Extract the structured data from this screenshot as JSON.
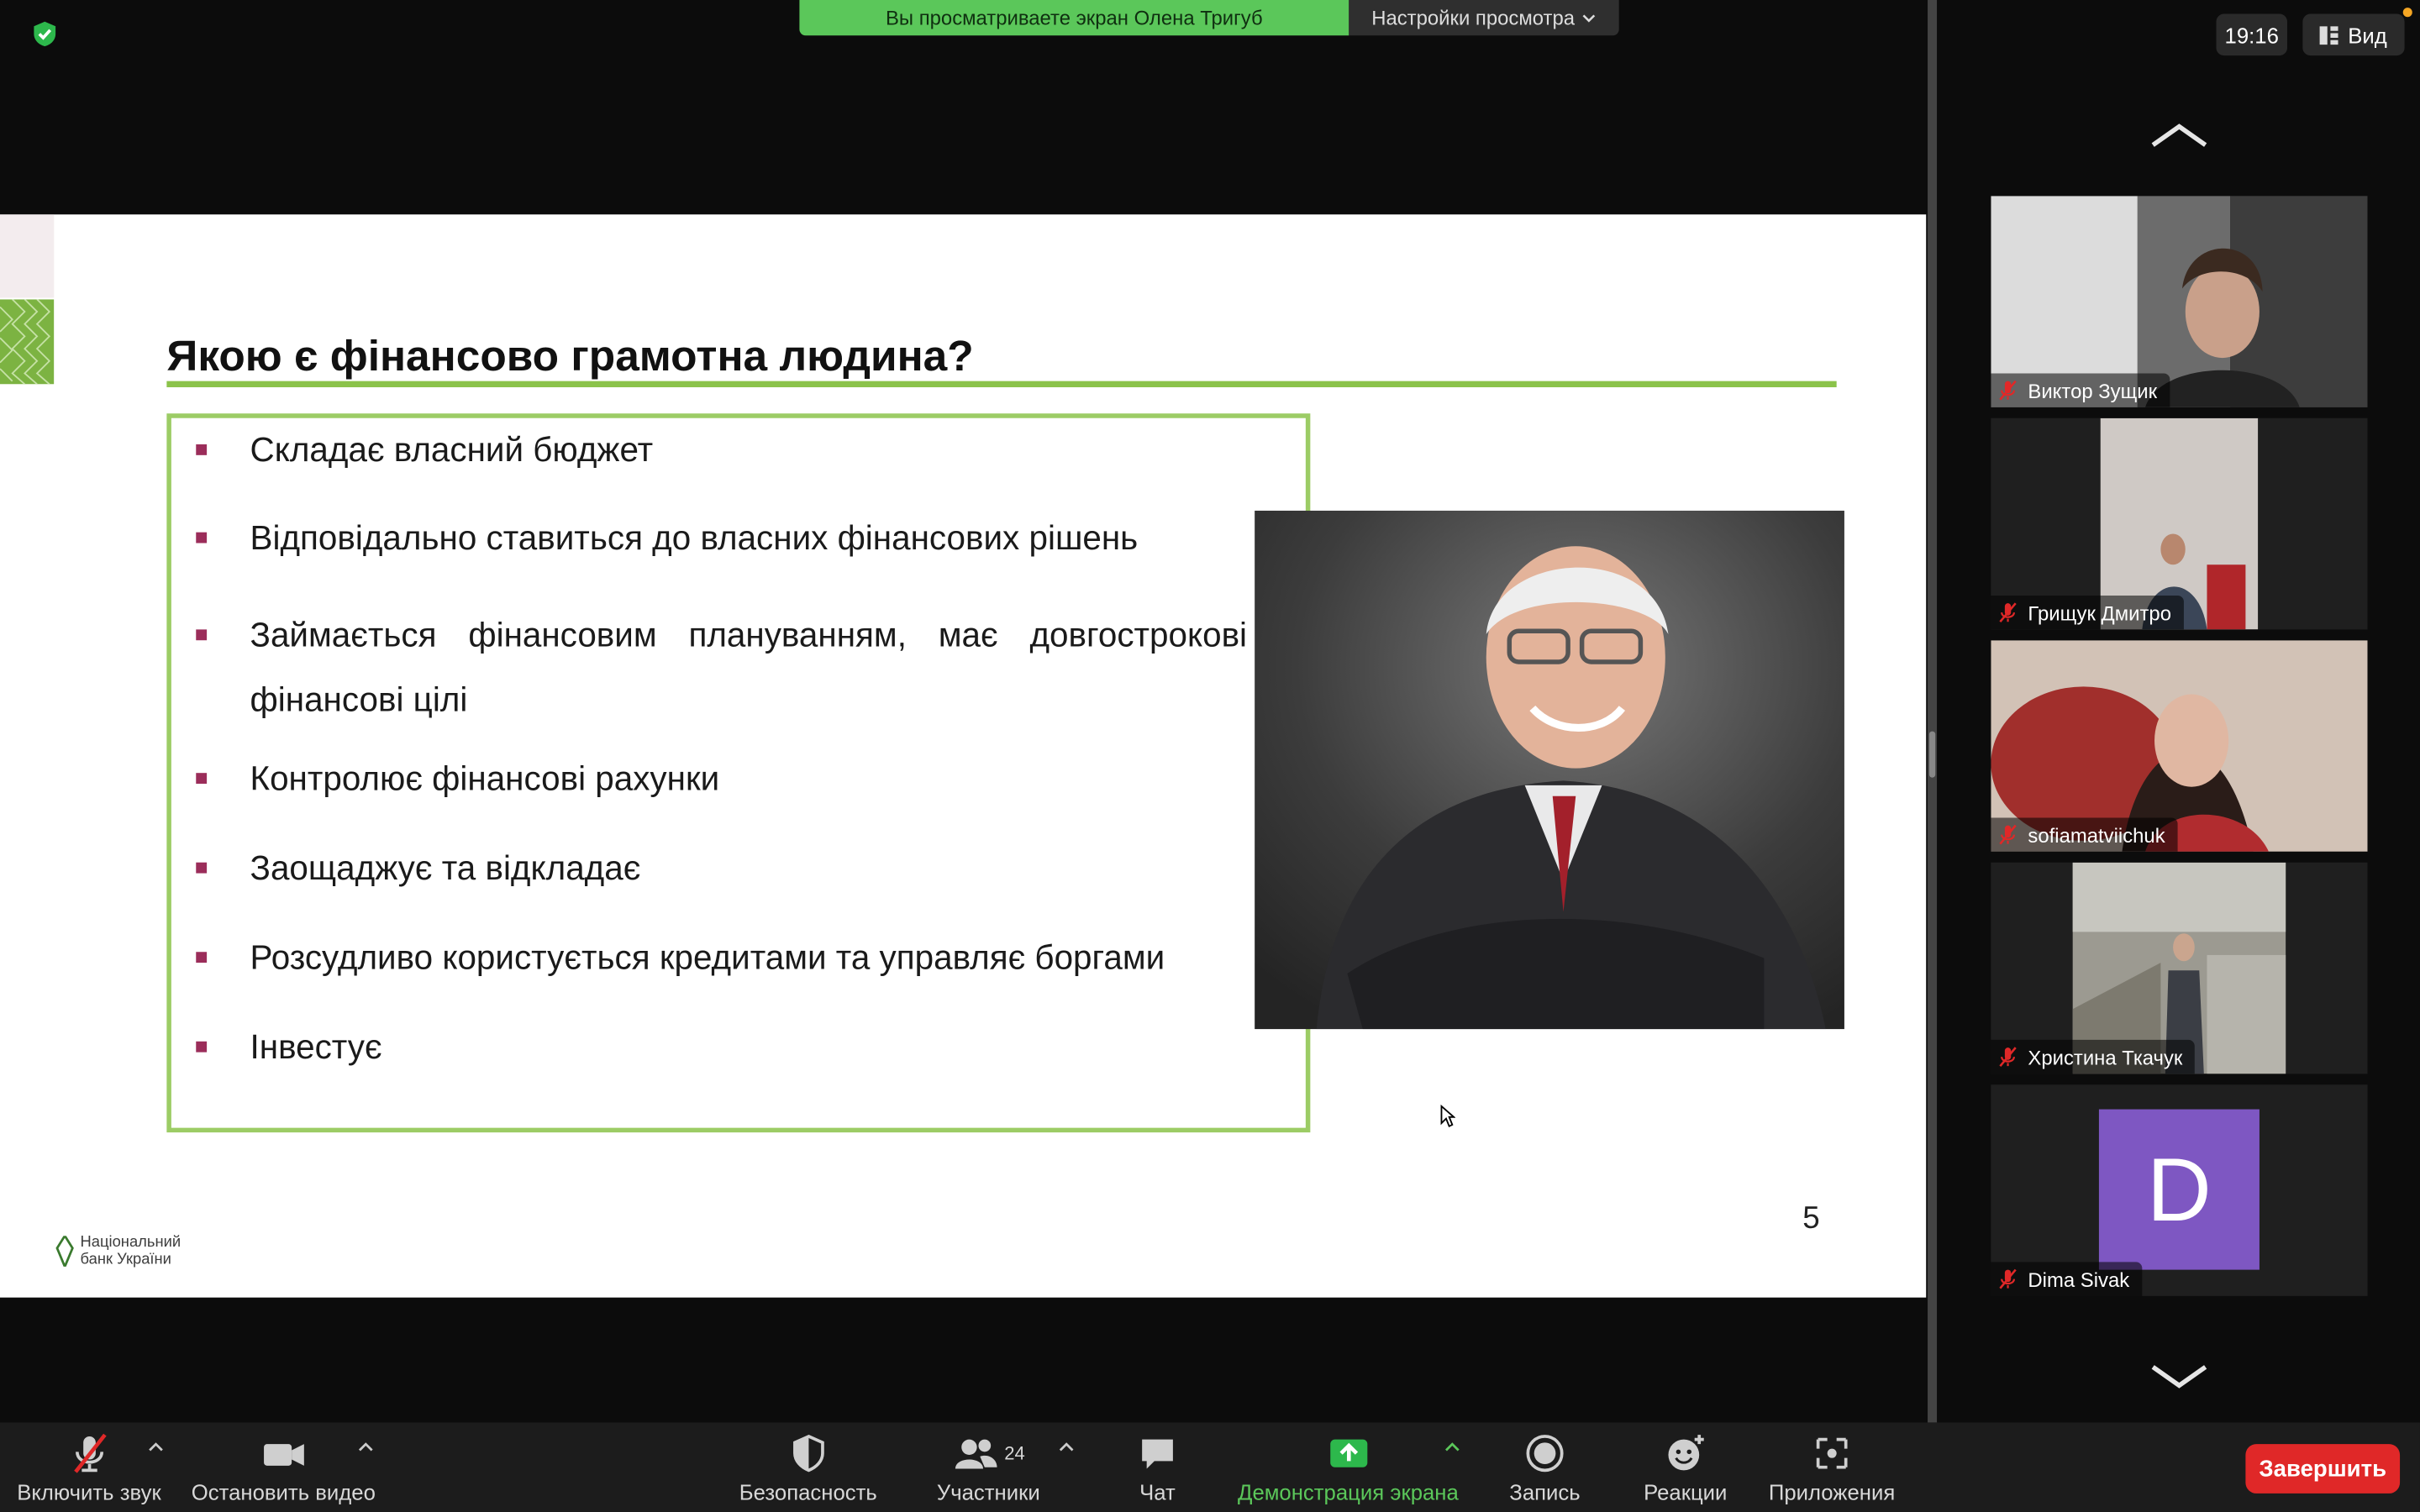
{
  "top": {
    "share_banner": "Вы просматриваете экран Олена Тригуб",
    "view_settings": "Настройки просмотра",
    "clock": "19:16",
    "view_label": "Вид"
  },
  "slide": {
    "title": "Якою є фінансово грамотна людина?",
    "bullets": [
      "Складає власний бюджет",
      "Відповідально ставиться до власних фінансових рішень",
      "Займається фінансовим плануванням, має довгострокові фінансові цілі",
      "Контролює фінансові рахунки",
      "Заощаджує та відкладає",
      "Розсудливо користується кредитами та управляє боргами",
      "Інвестує"
    ],
    "logo_line1": "Національний",
    "logo_line2": "банк України",
    "page_number": "5"
  },
  "participants": [
    {
      "name": "Виктор Зущик"
    },
    {
      "name": "Грищук Дмитро"
    },
    {
      "name": "sofiamatviichuk"
    },
    {
      "name": "Христина Ткачук"
    },
    {
      "name": "Dima Sivak",
      "initial": "D",
      "avatar_color": "#7e57c2"
    }
  ],
  "toolbar": {
    "unmute": "Включить звук",
    "stop_video": "Остановить видео",
    "security": "Безопасность",
    "participants": "Участники",
    "participants_count": "24",
    "chat": "Чат",
    "share_screen": "Демонстрация экрана",
    "record": "Запись",
    "reactions": "Реакции",
    "apps": "Приложения",
    "end": "Завершить"
  },
  "colors": {
    "accent_green": "#5bc75a",
    "slide_green": "#8bc34a",
    "bullet_mark": "#9b2d5a",
    "end_red": "#e02828"
  }
}
